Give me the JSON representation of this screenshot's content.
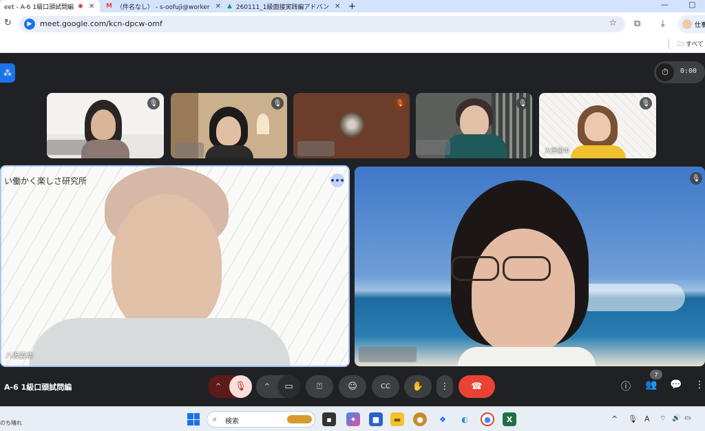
{
  "browser": {
    "tabs": [
      {
        "title": "eet - A-6 1級口頭試問編",
        "active": true
      },
      {
        "title": "（件名なし） - s-oofuji@worker",
        "active": false
      },
      {
        "title": "260111_1級面接実践編アドバン",
        "active": false
      }
    ],
    "new_tab": "+",
    "url": "meet.google.com/kcn-dpcw-omf",
    "profile_label": "仕事",
    "bookmark_folder": "すべて"
  },
  "meet": {
    "timer": "0:00",
    "meeting_name": "A-6 1級口頭試問編",
    "participants_count": "7",
    "tiles": {
      "small_5_name": "大澤里中",
      "main_left_name": "八坂義浩",
      "main_left_banner": "い働かく楽しさ研究所"
    }
  },
  "taskbar": {
    "weather": "のち晴れ",
    "search_placeholder": "検索",
    "lang_indicator": "A"
  },
  "colors": {
    "meet_bg": "#202124",
    "end_call": "#ea4335",
    "accent": "#1a73e8"
  }
}
